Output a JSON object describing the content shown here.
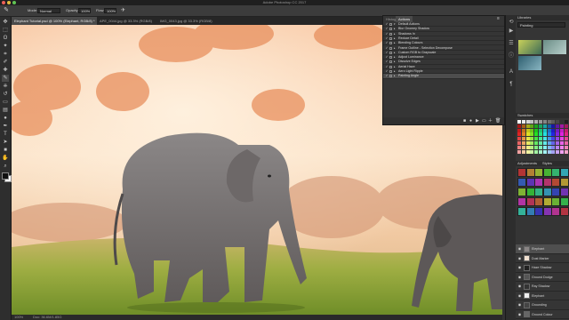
{
  "app": {
    "window_title": "Adobe Photoshop CC 2017"
  },
  "options_bar": {
    "tool_icon": "brush-tool-icon",
    "mode_label": "Mode:",
    "mode_value": "Normal",
    "opacity_label": "Opacity:",
    "opacity_value": "100%",
    "flow_label": "Flow:",
    "flow_value": "100%"
  },
  "tabs": [
    {
      "label": "Elephant Tutorial.psd @ 100% (Elephant, RGB/8) *",
      "active": true
    },
    {
      "label": "APE_0044.jpg @ 33.3% (RGB/8)",
      "active": false
    },
    {
      "label": "IMG_0043.jpg @ 33.3% (RGB/8)",
      "active": false
    }
  ],
  "status": {
    "zoom": "100%",
    "doc_size": "Doc: 36.6M/1.85G"
  },
  "actions_panel": {
    "tabs": [
      "Histogram",
      "Actions"
    ],
    "items": [
      {
        "label": "Default Actions",
        "checked": true,
        "expanded": true
      },
      {
        "label": "Blur Gnomey Shadow",
        "checked": true
      },
      {
        "label": "Shadows In",
        "checked": true
      },
      {
        "label": "Reduce Detail",
        "checked": true
      },
      {
        "label": "Blending Colours",
        "checked": true
      },
      {
        "label": "Frame Outline - Selection Decompose",
        "checked": true
      },
      {
        "label": "Custom RGB to Grayscale",
        "checked": true
      },
      {
        "label": "Adjust Luminance",
        "checked": true
      },
      {
        "label": "Dissolve Edges",
        "checked": true
      },
      {
        "label": "Aerial Haze",
        "checked": true
      },
      {
        "label": "Aero Light Ripple",
        "checked": true
      },
      {
        "label": "Painting Angle",
        "checked": true,
        "selected": true
      }
    ],
    "footer_icons": [
      "stop-icon",
      "record-icon",
      "play-icon",
      "new-set-icon",
      "new-action-icon",
      "trash-icon"
    ]
  },
  "right_panel": {
    "libraries_title": "Libraries",
    "library_name": "Painting",
    "swatches_title": "Swatches",
    "adjustments_title": "Adjustments",
    "styles_title": "Styles",
    "layers": [
      {
        "name": "Elephant",
        "selected": true
      },
      {
        "name": "Dust Marker",
        "selected": false
      },
      {
        "name": "Haze Shadow",
        "selected": false
      },
      {
        "name": "Ground Dodge",
        "selected": false
      },
      {
        "name": "Ray Shadow",
        "selected": false
      },
      {
        "name": "Elephant",
        "selected": false
      },
      {
        "name": "Grounding",
        "selected": false
      },
      {
        "name": "Ground Colour",
        "selected": false
      }
    ]
  },
  "colors": {
    "accent": "#f4b38a",
    "grass": "#8fa83a",
    "panel": "#353535"
  }
}
